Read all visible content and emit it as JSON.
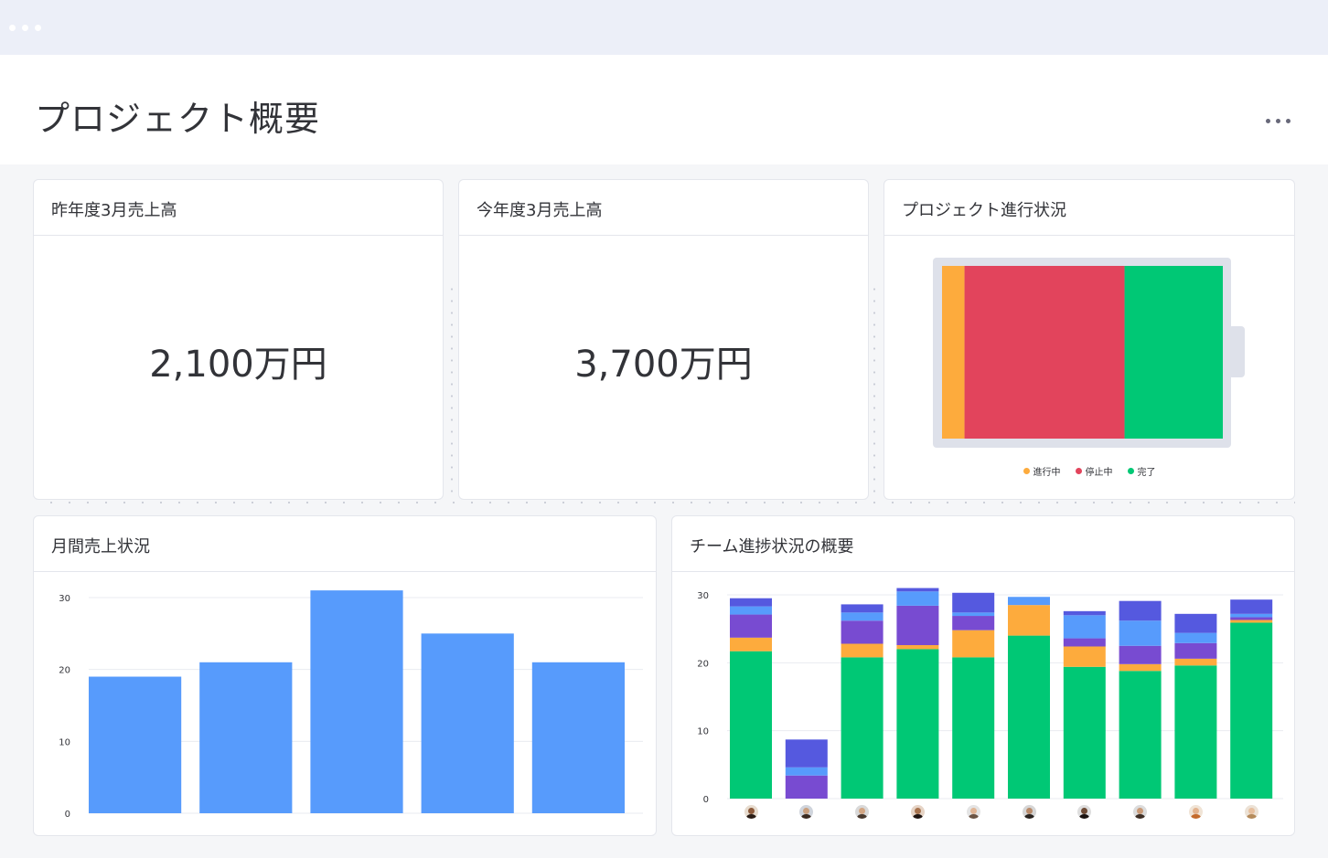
{
  "window": {
    "controls": [
      "dot",
      "dot",
      "dot"
    ]
  },
  "header": {
    "title": "プロジェクト概要",
    "more_icon": "more-horizontal-icon"
  },
  "cards": {
    "last_year": {
      "title": "昨年度3月売上高",
      "value": "2,100万円"
    },
    "this_year": {
      "title": "今年度3月売上高",
      "value": "3,700万円"
    },
    "progress": {
      "title": "プロジェクト進行状況",
      "legend": [
        {
          "label": "進行中",
          "color": "#fdab3d"
        },
        {
          "label": "停止中",
          "color": "#e2445c"
        },
        {
          "label": "完了",
          "color": "#00c875"
        }
      ]
    },
    "monthly": {
      "title": "月間売上状況"
    },
    "team": {
      "title": "チーム進捗状況の概要"
    }
  },
  "chart_data": [
    {
      "type": "bar",
      "orientation": "horizontal-stacked",
      "chart": "project-progress",
      "categories": [
        "進行中",
        "停止中",
        "完了"
      ],
      "values": [
        8,
        57,
        35
      ],
      "colors": [
        "#fdab3d",
        "#e2445c",
        "#00c875"
      ]
    },
    {
      "type": "bar",
      "chart": "monthly-sales",
      "categories": [
        "",
        "",
        "",
        "",
        ""
      ],
      "values": [
        19,
        21,
        31,
        25,
        21
      ],
      "ylim": [
        0,
        30
      ],
      "yticks": [
        "0",
        "10",
        "20",
        "30"
      ],
      "color": "#579bfc",
      "grid": true
    },
    {
      "type": "bar",
      "stacked": true,
      "chart": "team-progress",
      "categories": [
        "",
        "",
        "",
        "",
        "",
        "",
        "",
        "",
        "",
        ""
      ],
      "ylim": [
        0,
        30
      ],
      "yticks": [
        "0",
        "10",
        "20",
        "30"
      ],
      "grid": true,
      "series": [
        {
          "color": "#00c875",
          "values": [
            21.7,
            0,
            20.8,
            22,
            20.8,
            24,
            19.4,
            18.8,
            19.6,
            25.9
          ]
        },
        {
          "color": "#fdab3d",
          "values": [
            2,
            0,
            2,
            0.6,
            4,
            4.5,
            3,
            1,
            1,
            0.4
          ]
        },
        {
          "color": "#784bd1",
          "values": [
            3.4,
            3.4,
            3.4,
            5.8,
            2.1,
            0,
            1.2,
            2.7,
            2.3,
            0.4
          ]
        },
        {
          "color": "#579bfc",
          "values": [
            1.2,
            1.2,
            1.2,
            2.1,
            0.5,
            1.2,
            3.4,
            3.7,
            1.5,
            0.5
          ]
        },
        {
          "color": "#5559df",
          "values": [
            1.2,
            4.1,
            1.2,
            0.5,
            2.9,
            0,
            0.6,
            2.9,
            2.8,
            2.1
          ]
        }
      ],
      "avatars": [
        {
          "skin": "#8d5a3b",
          "hair": "#2b1d16",
          "bg": "#e7dccf"
        },
        {
          "skin": "#c9a07f",
          "hair": "#3a2a20",
          "bg": "#cfd4dc"
        },
        {
          "skin": "#d3a683",
          "hair": "#4a3a2e",
          "bg": "#d9d9d9"
        },
        {
          "skin": "#a8744f",
          "hair": "#1e1410",
          "bg": "#e6d4c6"
        },
        {
          "skin": "#e0b596",
          "hair": "#6b5444",
          "bg": "#e4e4e4"
        },
        {
          "skin": "#b88a6a",
          "hair": "#2a2420",
          "bg": "#d6d6d6"
        },
        {
          "skin": "#6d4a35",
          "hair": "#1a1210",
          "bg": "#dedede"
        },
        {
          "skin": "#c99a78",
          "hair": "#3e2f26",
          "bg": "#dcdcdc"
        },
        {
          "skin": "#e3b38e",
          "hair": "#c46a2b",
          "bg": "#f0e4d6"
        },
        {
          "skin": "#e7c09f",
          "hair": "#b58b5b",
          "bg": "#ece2d6"
        }
      ]
    }
  ]
}
